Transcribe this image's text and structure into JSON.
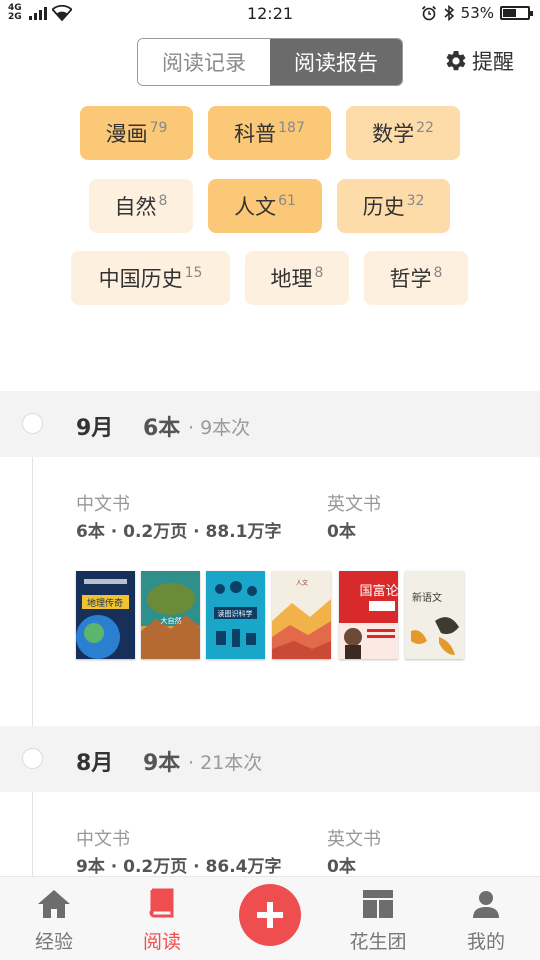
{
  "status_bar": {
    "network": "4G\n2G",
    "time": "12:21",
    "battery": "53%",
    "icons": [
      "signal-icon",
      "wifi-icon",
      "alarm-icon",
      "bluetooth-icon",
      "battery-icon"
    ]
  },
  "header": {
    "tabs": [
      {
        "label": "阅读记录",
        "active": false
      },
      {
        "label": "阅读报告",
        "active": true
      }
    ],
    "remind_label": "提醒",
    "remind_icon": "gear-icon"
  },
  "tags": [
    {
      "name": "漫画",
      "count": "79",
      "level": 3
    },
    {
      "name": "科普",
      "count": "187",
      "level": 3
    },
    {
      "name": "数学",
      "count": "22",
      "level": 2
    },
    {
      "name": "自然",
      "count": "8",
      "level": 1
    },
    {
      "name": "人文",
      "count": "61",
      "level": 3
    },
    {
      "name": "历史",
      "count": "32",
      "level": 2
    },
    {
      "name": "中国历史",
      "count": "15",
      "level": 1
    },
    {
      "name": "地理",
      "count": "8",
      "level": 1
    },
    {
      "name": "哲学",
      "count": "8",
      "level": 1
    }
  ],
  "months": [
    {
      "month": "9月",
      "books": "6本",
      "times": "· 9本次",
      "chinese_label": "中文书",
      "chinese_value": "6本 · 0.2万页 · 88.1万字",
      "english_label": "英文书",
      "english_value": "0本",
      "covers": [
        {
          "title": "地理传奇",
          "bg": "#16305a",
          "accent": "#f2c230"
        },
        {
          "title": "大自然",
          "bg": "#2f8f8a",
          "accent": "#d9a04a"
        },
        {
          "title": "读图识科学",
          "bg": "#1aa6c9",
          "accent": "#0b3f66"
        },
        {
          "title": "人文",
          "bg": "#f3ede2",
          "accent": "#e26a4a"
        },
        {
          "title": "国富论",
          "bg": "#d82a2a",
          "accent": "#ffffff"
        },
        {
          "title": "新语文",
          "bg": "#f1efe6",
          "accent": "#3e3c2e"
        }
      ]
    },
    {
      "month": "8月",
      "books": "9本",
      "times": "· 21本次",
      "chinese_label": "中文书",
      "chinese_value": "9本 · 0.2万页 · 86.4万字",
      "english_label": "英文书",
      "english_value": "0本"
    }
  ],
  "bottom_nav": [
    {
      "label": "经验",
      "icon": "home-icon",
      "active": false
    },
    {
      "label": "阅读",
      "icon": "book-icon",
      "active": true
    },
    {
      "label": "",
      "icon": "add-icon",
      "active": false
    },
    {
      "label": "花生团",
      "icon": "group-icon",
      "active": false
    },
    {
      "label": "我的",
      "icon": "profile-icon",
      "active": false
    }
  ],
  "colors": {
    "accent_red": "#ef4e51",
    "tag_strong": "#fbc878",
    "tag_medium": "#fddcaa",
    "tag_light": "#fdf0df",
    "toggle_active": "#6b6b6b"
  }
}
